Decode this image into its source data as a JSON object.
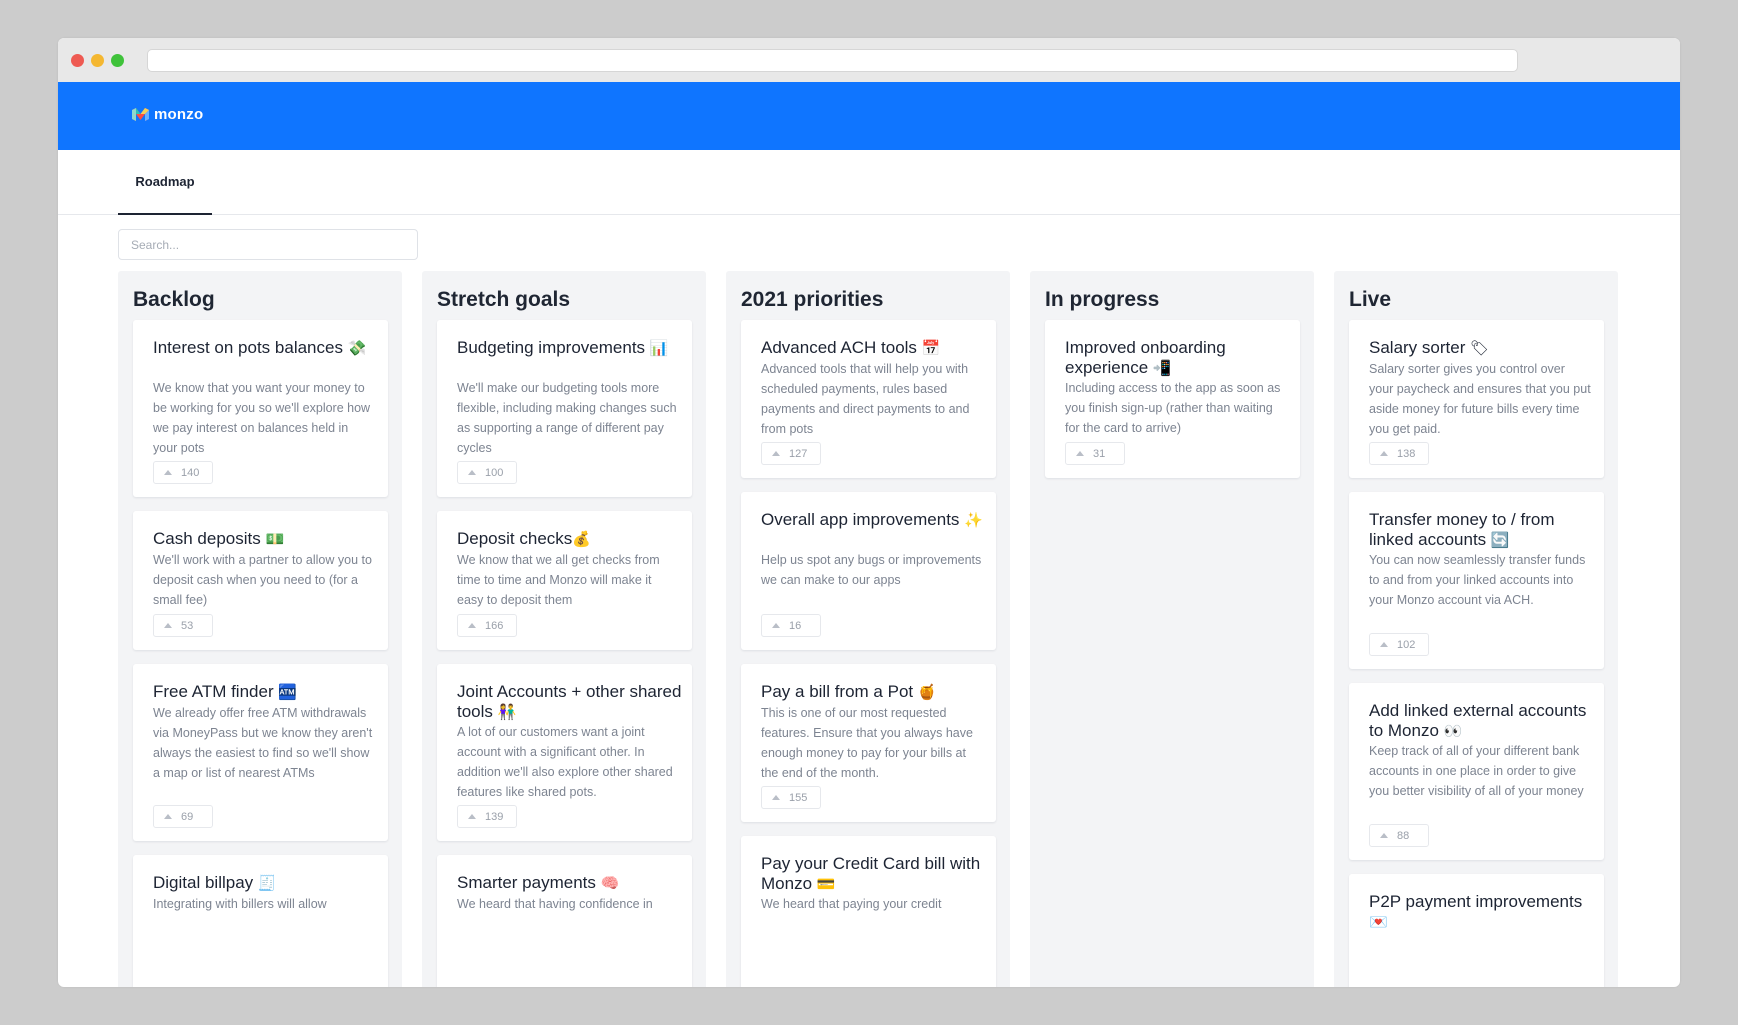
{
  "app": {
    "logo_text": "monzo"
  },
  "tabs": [
    {
      "label": "Roadmap"
    }
  ],
  "search": {
    "placeholder": "Search..."
  },
  "columns": [
    {
      "title": "Backlog",
      "cards": [
        {
          "title": "Interest on pots balances",
          "emoji": "💸",
          "description": "We know that you want your money to be working for you so we'll explore how we pay interest on balances held in your pots",
          "votes": "140"
        },
        {
          "title": "Cash deposits",
          "emoji": "💵",
          "description": "We'll work with a partner to allow you to deposit cash when you need to (for a small fee)",
          "votes": "53"
        },
        {
          "title": "Free ATM finder",
          "emoji": "🏧",
          "description": "We already offer free ATM withdrawals via MoneyPass but we know they aren't always the easiest to find so we'll show a map or list of nearest ATMs",
          "votes": "69"
        },
        {
          "title": "Digital billpay",
          "emoji": "🧾",
          "description": "Integrating with billers will allow",
          "votes": ""
        }
      ]
    },
    {
      "title": "Stretch goals",
      "cards": [
        {
          "title": "Budgeting improvements",
          "emoji": "📊",
          "description": "We'll make our budgeting tools more flexible, including making changes such as supporting a range of different pay cycles",
          "votes": "100"
        },
        {
          "title": "Deposit checks",
          "emoji": "💰",
          "description": "We know that we all get checks from time to time and Monzo will make it easy to deposit them",
          "votes": "166"
        },
        {
          "title": "Joint Accounts + other shared tools",
          "emoji": "👫",
          "description": "A lot of our customers want a joint account with a significant other. In addition we'll also explore other shared features like shared pots.",
          "votes": "139"
        },
        {
          "title": "Smarter payments",
          "emoji": "🧠",
          "description": "We heard that having confidence in",
          "votes": ""
        }
      ]
    },
    {
      "title": "2021 priorities",
      "cards": [
        {
          "title": "Advanced ACH tools",
          "emoji": "📅",
          "description": "Advanced tools that will help you with scheduled payments, rules based payments and direct payments to and from pots",
          "votes": "127"
        },
        {
          "title": "Overall app improvements",
          "emoji": "✨",
          "description": "Help us spot any bugs or improvements we can make to our apps",
          "votes": "16"
        },
        {
          "title": "Pay a bill from a Pot",
          "emoji": "🍯",
          "description": "This is one of our most requested features. Ensure that you always have enough money to pay for your bills at the end of the month.",
          "votes": "155"
        },
        {
          "title": "Pay your Credit Card bill with Monzo",
          "emoji": "💳",
          "description": "We heard that paying your credit",
          "votes": ""
        }
      ]
    },
    {
      "title": "In progress",
      "cards": [
        {
          "title": "Improved onboarding experience",
          "emoji": "📲",
          "description": "Including access to the app as soon as you finish sign-up (rather than waiting for the card to arrive)",
          "votes": "31"
        }
      ]
    },
    {
      "title": "Live",
      "cards": [
        {
          "title": "Salary sorter",
          "emoji": "🏷",
          "description": "Salary sorter gives you control over your paycheck and ensures that you put aside money for future bills every time you get paid.",
          "votes": "138"
        },
        {
          "title": "Transfer money to / from linked accounts",
          "emoji": "🔄",
          "description": "You can now seamlessly transfer funds to and from your linked accounts into your Monzo account via ACH.",
          "votes": "102"
        },
        {
          "title": "Add linked external accounts to Monzo",
          "emoji": "👀",
          "description": "Keep track of all of your different bank accounts in one place in order to give you better visibility of all of your money",
          "votes": "88"
        },
        {
          "title": "P2P payment improvements",
          "emoji": "💌",
          "description": "",
          "votes": ""
        }
      ]
    }
  ]
}
